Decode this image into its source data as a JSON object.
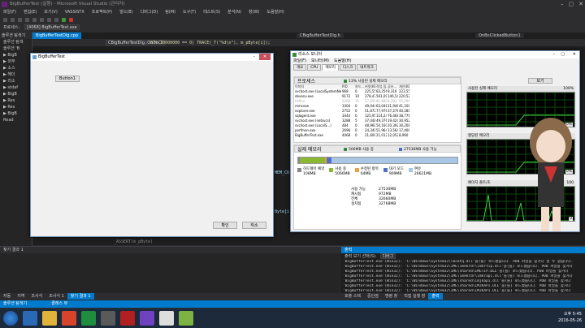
{
  "vs": {
    "title": "BigBufferTest (실행) - Microsoft Visual Studio (관리자)",
    "menu": [
      "파일(F)",
      "편집(E)",
      "보기(V)",
      "VASSISTX",
      "프로젝트(P)",
      "빌드(B)",
      "디버그(D)",
      "팀(M)",
      "도구(T)",
      "테스트(S)",
      "분석(N)",
      "창(W)",
      "도움말(H)"
    ],
    "process_label": "프로세스:",
    "process_value": "[4068] BigBufferTest.exe",
    "code_combo1": "CBigBufferTestDlg::OnBnCl",
    "code_combo2": "* GetApplicationPath",
    "code_line": "0 % 10000000 == 0) TRACE(_T(\"%d\\n\"), m_pByte[i]);",
    "doc_tab1": "BigBufferTestDlg.cpp",
    "doc_tab2": "CBigBufferTestDlg.h",
    "doc_tab3": "OnBnClickedButton1",
    "code_text_1": "MEM_CO",
    "code_text_2": "Byte[i",
    "code_text_3": "_ASSERT(m_pByte)"
  },
  "sol": {
    "title": "솔루션 탐색기",
    "items": [
      "솔루션 탐색",
      "솔루션 'B",
      "▶ BigB",
      "  ▶ 외부",
      "  ▶ 소스",
      "  ▶ 헤더",
      "  ▶ 리소",
      "  ▶ stdaf",
      "  ▶ BigB",
      "  ▶ Res",
      "  ▶ Res",
      "  ▶ BigB",
      "  Read"
    ],
    "footer": "솔루션 탐색기"
  },
  "dialog": {
    "title": "BigBufferTest",
    "button1": "Button1",
    "ok": "확인",
    "cancel": "취소"
  },
  "taskmgr": {
    "title": "리소스 모니터",
    "menu": [
      "파일(F)",
      "모니터(M)",
      "도움말(H)"
    ],
    "tabs": [
      "개요",
      "CPU",
      "메모리",
      "디스크",
      "네트워크"
    ],
    "process_section": "프로세스",
    "cpu_usage": "13% 사용된 실제 메모리",
    "columns": [
      "이미지",
      "PID",
      "하드...",
      "커밋(KB)",
      "작업 집...",
      "공유...",
      "개인(KB)"
    ],
    "rows": [
      [
        "svchost.exe (LocalSystemNetwo",
        "968",
        "0",
        "225,556",
        "83,256",
        "9,316",
        "223,552"
      ],
      [
        "devenv.exe",
        "9172",
        "10",
        "278,476",
        "561,094",
        "146,544",
        "220,520"
      ],
      [
        "tlsfine",
        "2268",
        "11",
        "57,656",
        "81,680",
        "8,392",
        "55,296"
      ],
      [
        "mmcexe",
        "3304",
        "0",
        "49,044",
        "63,048",
        "21,948",
        "41,100"
      ],
      [
        "explorer.exe",
        "2752",
        "0",
        "51,872",
        "77,976",
        "37,276",
        "40,280"
      ],
      [
        "sqlagent.exe",
        "3444",
        "0",
        "125,956",
        "114,246",
        "76,468",
        "38,776"
      ],
      [
        "svchost.exe (netsvcs)",
        "3288",
        "5",
        "37,048",
        "49,376",
        "19,424",
        "30,952"
      ],
      [
        "svchost.exe (LocalS...)",
        "484",
        "0",
        "48,960",
        "50,160",
        "20,392",
        "30,208"
      ],
      [
        "perfmon.exe",
        "2696",
        "0",
        "24,340",
        "51,964",
        "13,564",
        "17,400"
      ],
      [
        "BigBufferTest.exe",
        "4068",
        "0",
        "21,600",
        "21,012",
        "12,052",
        "8,960"
      ]
    ],
    "mem_section": "실제 메모리",
    "mem_usage": "506MB 사용 중",
    "mem_avail": "27536MB 사용 가능",
    "legend": [
      {
        "label": "하드웨어 예약",
        "value": "108MB",
        "color": "#888888"
      },
      {
        "label": "사용 중",
        "value": "5066MB",
        "color": "#8ab832"
      },
      {
        "label": "수정된 항목",
        "value": "64MB",
        "color": "#e8a040"
      },
      {
        "label": "대기 모드",
        "value": "909MB",
        "color": "#4e6fc6"
      },
      {
        "label": "여유",
        "value": "26621MB",
        "color": "#a9c6e6"
      }
    ],
    "stats": [
      [
        "사용 가능",
        "27530MB"
      ],
      [
        "캐시됨",
        "972MB"
      ],
      [
        "전체",
        "32660MB"
      ],
      [
        "설치됨",
        "32768MB"
      ]
    ],
    "view_btn": "보기",
    "graphs": [
      {
        "title": "사용된 실제 메모리",
        "pct_top": "100%",
        "pct_bottom": "0%"
      },
      {
        "title": "할당된 메모리",
        "pct_top": "",
        "pct_bottom": "0%"
      },
      {
        "title": "페이지 폴트/초",
        "pct_top": "100",
        "pct_bottom": "0"
      }
    ]
  },
  "bottom": {
    "find_title": "찾기 결과 1",
    "output_title": "출력",
    "output_source_label": "출력 보기 선택(S):",
    "output_source": "디버그",
    "output_lines": [
      "'BigBufferTest.exe'(Win32): 'C:\\Windows\\System32\\lbcatq.dll'을(를) 로드했습니다. PDB 파일을 찾거나 열 수 없습니다.",
      "'BigBufferTest.exe'(Win32): 'C:\\Windows\\System32\\IME\\imekrdr\\imkrtip.dll'을(를) 로드했습니다. PDB 파일을 찾거나",
      "'BigBufferTest.exe'(Win32): 'C:\\Windows\\System32\\IME\\shared\\IMETIP.DLL'을(를) 로드했습니다. PDB 파일을 찾거나",
      "'BigBufferTest.exe'(Win32): 'C:\\Windows\\System32\\IME\\imekrdr\\imkrapi.dll'을(를) 로드했습니다. PDB 파일을 찾거나",
      "'BigBufferTest.exe'(Win32): 'C:\\Windows\\System32\\IME\\shared\\imjkapi.dll'을(를) 로드했습니다. PDB 파일을 찾거나",
      "'BigBufferTest.exe'(Win32): 'C:\\Windows\\System32\\IME\\shared\\IMJKAPI.DLL'을(를) 로드했습니다. PDB 파일을 찾거나",
      "'BigBufferTest.exe'(Win32): 'C:\\Windows\\System32\\IME\\shared\\IMJKAPI.DLL'을(를) 로드했습니다. PDB 파일을 찾거나"
    ],
    "tabs_left": [
      "자동",
      "지역",
      "조사식",
      "조사식 1",
      "찾기 결과 1"
    ],
    "tabs_right": [
      "호출 스택",
      "중단점",
      "명령 창",
      "직접 실행 창",
      "출력"
    ],
    "status": [
      "솔루션 탐색기",
      "클래스 뷰"
    ]
  },
  "taskbar": {
    "time": "오후 5:45",
    "date": "2016-05-26"
  }
}
